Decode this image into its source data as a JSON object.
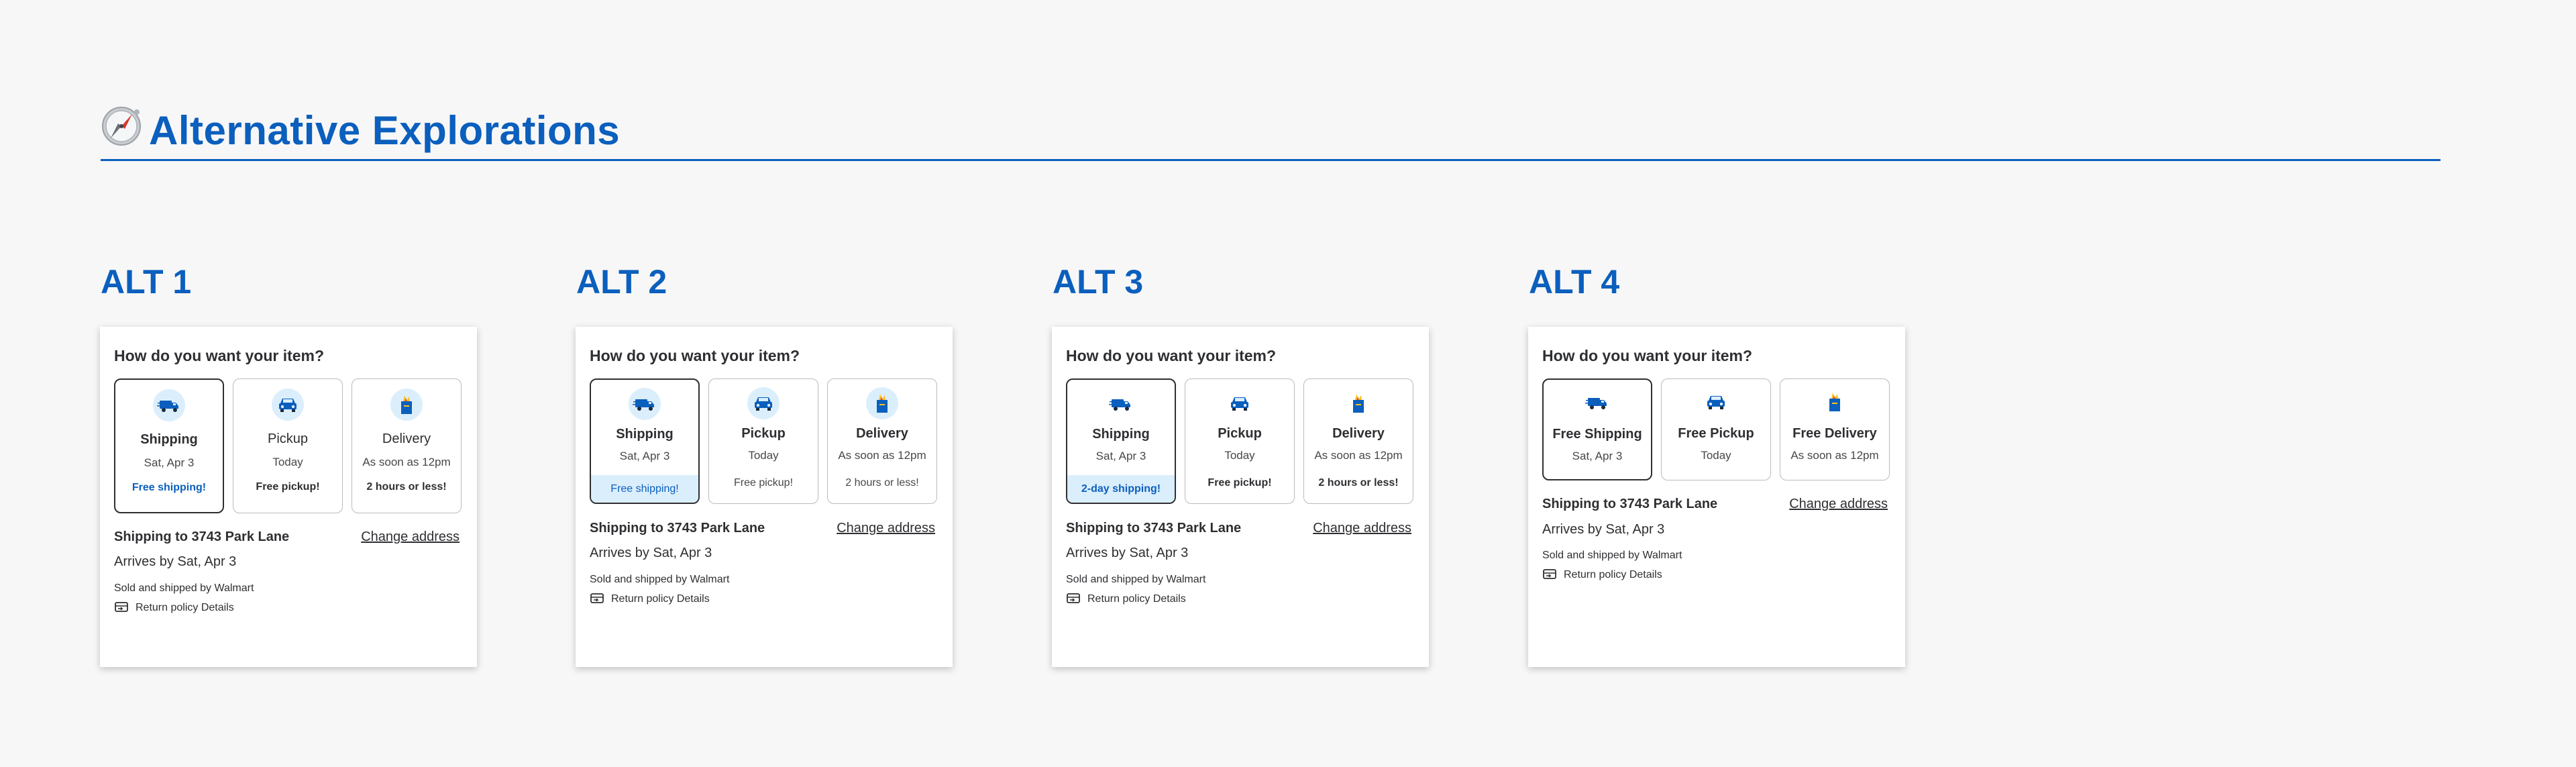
{
  "header": {
    "title": "Alternative Explorations",
    "icon": "compass-icon"
  },
  "colors": {
    "accent": "#0b5fbd",
    "tint": "#dbeefc",
    "text": "#2e2f32"
  },
  "alts": [
    {
      "label": "ALT 1",
      "question": "How do you want your item?",
      "options": [
        {
          "name": "Shipping",
          "detail": "Sat, Apr 3",
          "badge": "Free shipping!",
          "icon": "truck-icon",
          "selected": true
        },
        {
          "name": "Pickup",
          "detail": "Today",
          "badge": "Free pickup!",
          "icon": "car-icon",
          "selected": false
        },
        {
          "name": "Delivery",
          "detail": "As soon as 12pm",
          "badge": "2 hours or less!",
          "icon": "bag-icon",
          "selected": false
        }
      ],
      "shipping_to": "Shipping to 3743 Park Lane",
      "change_address": "Change address",
      "arrives": "Arrives by Sat, Apr 3",
      "sold_by": "Sold and shipped by Walmart",
      "return_policy": "Return policy Details"
    },
    {
      "label": "ALT 2",
      "question": "How do you want your item?",
      "options": [
        {
          "name": "Shipping",
          "detail": "Sat, Apr 3",
          "badge": "Free shipping!",
          "icon": "truck-icon",
          "selected": true
        },
        {
          "name": "Pickup",
          "detail": "Today",
          "badge": "Free pickup!",
          "icon": "car-icon",
          "selected": false
        },
        {
          "name": "Delivery",
          "detail": "As soon as 12pm",
          "badge": "2 hours or less!",
          "icon": "bag-icon",
          "selected": false
        }
      ],
      "shipping_to": "Shipping to 3743 Park Lane",
      "change_address": "Change address",
      "arrives": "Arrives by Sat, Apr 3",
      "sold_by": "Sold and shipped by Walmart",
      "return_policy": "Return policy Details"
    },
    {
      "label": "ALT 3",
      "question": "How do you want your item?",
      "options": [
        {
          "name": "Shipping",
          "detail": "Sat, Apr 3",
          "badge": "2-day shipping!",
          "icon": "truck-icon",
          "selected": true
        },
        {
          "name": "Pickup",
          "detail": "Today",
          "badge": "Free pickup!",
          "icon": "car-icon",
          "selected": false
        },
        {
          "name": "Delivery",
          "detail": "As soon as 12pm",
          "badge": "2 hours or less!",
          "icon": "bag-icon",
          "selected": false
        }
      ],
      "shipping_to": "Shipping to 3743 Park Lane",
      "change_address": "Change address",
      "arrives": "Arrives by Sat, Apr 3",
      "sold_by": "Sold and shipped by Walmart",
      "return_policy": "Return policy Details"
    },
    {
      "label": "ALT 4",
      "question": "How do you want your item?",
      "options": [
        {
          "name": "Free Shipping",
          "detail": "Sat, Apr 3",
          "icon": "truck-icon",
          "selected": true
        },
        {
          "name": "Free Pickup",
          "detail": "Today",
          "icon": "car-icon",
          "selected": false
        },
        {
          "name": "Free Delivery",
          "detail": "As soon as 12pm",
          "icon": "bag-icon",
          "selected": false
        }
      ],
      "shipping_to": "Shipping to 3743 Park Lane",
      "change_address": "Change address",
      "arrives": "Arrives by Sat, Apr 3",
      "sold_by": "Sold and shipped by Walmart",
      "return_policy": "Return policy Details"
    }
  ]
}
